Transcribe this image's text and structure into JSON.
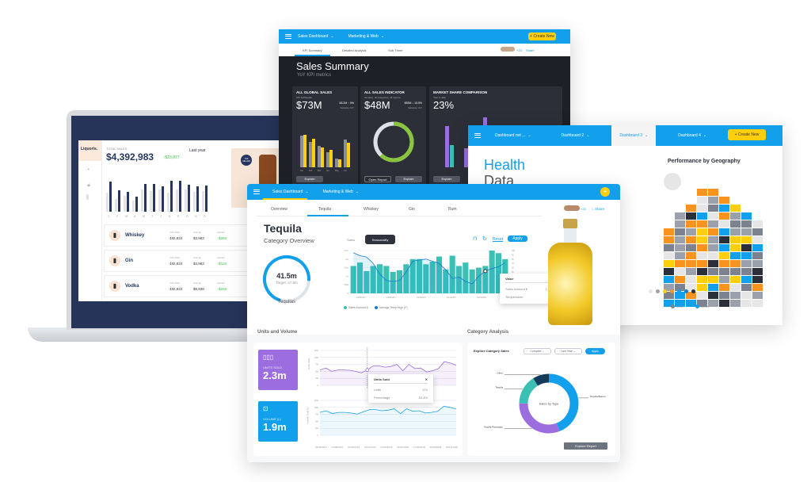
{
  "colors": {
    "blue": "#12a0ec",
    "teal": "#3cc0b6",
    "purple": "#9c6ddf",
    "yellow": "#ffcf0d",
    "navy": "#26365e",
    "dark": "#1d2027",
    "card": "#2c2f38",
    "green": "#8ac43f"
  },
  "laptop": {
    "logo": "Liquoris.",
    "total_label": "TOTAL SALES",
    "total_value": "$4,392,983",
    "delta": "↑$23,877",
    "period": "Last year",
    "months": [
      "J",
      "F",
      "M",
      "A",
      "M",
      "J",
      "J",
      "A",
      "S",
      "O",
      "N",
      "D"
    ],
    "bars_current": [
      85,
      60,
      55,
      42,
      78,
      78,
      72,
      86,
      86,
      75,
      72,
      74
    ],
    "bars_prev": [
      60,
      40,
      50,
      35,
      70,
      65,
      70,
      60,
      70,
      70,
      62,
      65
    ],
    "promo_badge": "TOP SELLER",
    "rows": [
      {
        "name": "Whiskey",
        "volume_label": "VOLUME",
        "volume": "492,834",
        "value_label": "VALUE",
        "value": "$3,983",
        "sales_label": "SALES",
        "sales": "↑$360"
      },
      {
        "name": "Gin",
        "volume_label": "VOLUME",
        "volume": "492,834",
        "value_label": "VALUE",
        "value": "$4,983",
        "sales_label": "SALES",
        "sales": "↑$120"
      },
      {
        "name": "Vodka",
        "volume_label": "VOLUME",
        "volume": "492,834",
        "value_label": "VALUE",
        "value": "$9,938",
        "sales_label": "SALES",
        "sales": "↑$340"
      }
    ]
  },
  "dark": {
    "nav": [
      "Sales Dashboard",
      "Marketing & Web"
    ],
    "create": "+ Create New",
    "tabs": [
      "KPI Summary",
      "Detailed Analysis",
      "Sub Three"
    ],
    "share": "Share",
    "count": "+23",
    "title": "Sales Summary",
    "subtitle": "YoY KPI metrics",
    "cards": [
      {
        "title": "ALL GLOBAL SALES",
        "sub": "KPI Subheader",
        "value": "$73M",
        "delta": "68.2M ↑ 9%",
        "delta_sub": "Variance YoY",
        "button": "Explain",
        "months": [
          "Jan",
          "Feb",
          "Mar",
          "Apr",
          "May",
          "Jun"
        ],
        "gray": [
          88,
          72,
          60,
          42,
          25,
          78
        ],
        "yellow": [
          92,
          80,
          55,
          50,
          22,
          70
        ]
      },
      {
        "title": "ALL SALES INDICATOR",
        "sub": "All sales, all categories, all regions",
        "value": "$48M",
        "delta": "$53M ↓ 13.5%",
        "delta_sub": "Variance YoY",
        "button": "Explain",
        "button2": "Open Report",
        "progress": 0.62
      },
      {
        "title": "MARKET SHARE COMPARISON",
        "sub": "Year to date",
        "value": "23%",
        "button": "Explain",
        "purple": [
          75,
          35,
          90
        ],
        "teal": [
          40,
          20,
          60
        ]
      }
    ]
  },
  "health": {
    "nav": [
      "Dashboard not ...",
      "Dashboard 2",
      "Dashboard 3",
      "Dashboard 4"
    ],
    "create": "+ Create New",
    "title1": "Health",
    "title2": "Data",
    "map_title": "Performance by Geography",
    "legend": [
      {
        "label": "2017",
        "color": "#7d8290"
      },
      {
        "label": "2018",
        "color": "#12a0ec"
      }
    ],
    "scale_colors": [
      "#e6e6e6",
      "#9aa1ad",
      "#ffcf0d",
      "#f7931e",
      "#12a0ec",
      "#0d7fd0",
      "#2b2f3a"
    ],
    "map_colors": [
      "#e6e6e6",
      "#9aa1ad",
      "#ffcf0d",
      "#f7931e",
      "#12a0ec",
      "#2b2f3a",
      "#7d8290"
    ]
  },
  "front": {
    "nav": [
      "Sales Dashboard",
      "Marketing & Web"
    ],
    "tabs": [
      "Overview",
      "Tequila",
      "Whiskey",
      "Gin",
      "Rum"
    ],
    "active_tab": 1,
    "count": "+23",
    "share": "Share",
    "title": "Tequila",
    "subtitle": "Category Overview",
    "gauge": {
      "value": "41.5m",
      "target": "Target: 47.8m",
      "label": "Tequilas",
      "fraction": 0.87
    },
    "toggle": [
      "Sales",
      "Seasonality"
    ],
    "reset": "Reset",
    "apply": "Apply",
    "chart": {
      "bars": [
        1.6,
        1.8,
        1.3,
        1.6,
        1.7,
        1.6,
        1.25,
        1.35,
        1.7,
        2.0,
        2.0,
        1.7,
        1.85,
        2.15,
        1.4,
        2.2,
        1.6,
        1.8,
        1.4,
        1.5,
        1.6,
        2.5,
        2.35,
        2.0
      ],
      "line": [
        95,
        88,
        85,
        70,
        45,
        30,
        28,
        30,
        50,
        75,
        78,
        80,
        75,
        70,
        55,
        35,
        38,
        28,
        22,
        40,
        52,
        58,
        62,
        72
      ],
      "y_left": [
        "0",
        "500k",
        "1m",
        "1.5m",
        "2m",
        "2.5m"
      ],
      "y_right": [
        "0",
        "10",
        "20",
        "30",
        "40",
        "50",
        "60",
        "70",
        "80",
        "90",
        "100"
      ],
      "x": [
        "01/06/2017",
        "01/08/2017",
        "01/09/2017",
        "01/12/2017",
        "01/03/2018",
        "01/05/2018"
      ],
      "legend": [
        "Sales Amount $",
        "Average Temp High (F)"
      ]
    },
    "tooltip": {
      "title": "Value",
      "rows": [
        [
          "Sales Amount $",
          "1,573,209"
        ],
        [
          "Temperature",
          "62"
        ]
      ]
    },
    "units_title": "Units and Volume",
    "units": {
      "label": "UNITS SOLD",
      "value": "2.3m"
    },
    "volume": {
      "label": "VOLUME (L)",
      "value": "1.9m"
    },
    "units_line": [
      55,
      62,
      50,
      55,
      55,
      54,
      50,
      45,
      55,
      70,
      70,
      65,
      68,
      75,
      52,
      75,
      60,
      62,
      48,
      52,
      60,
      85,
      80,
      72
    ],
    "volume_line": [
      82,
      88,
      78,
      82,
      82,
      80,
      76,
      84,
      92,
      92,
      88,
      90,
      95,
      78,
      95,
      86,
      88,
      80,
      82,
      86,
      104,
      100,
      94
    ],
    "units_axis": "Units Sold",
    "volume_axis": "Volume Sold (L)",
    "y_ticks": [
      "0",
      "25k",
      "50k",
      "75k",
      "100k",
      "125k"
    ],
    "x_ticks": [
      "01/06/2017",
      "01/08/2017",
      "01/09/2017",
      "01/12/2017",
      "01/02/2018",
      "01/03/2018",
      "01/05/2018",
      "01/08/2018",
      "01/12/2018"
    ],
    "units_tooltip": {
      "title": "Units Sold",
      "rows": [
        [
          "Units",
          "57k"
        ],
        [
          "Percentage",
          "53.4%"
        ]
      ]
    },
    "category_title": "Category Analysis",
    "explore": "Explore Category Sales",
    "compare": "Compare",
    "period": "Last Year",
    "donut": {
      "center": "Sales by Type",
      "slices": [
        {
          "label": "Tequila Blanco",
          "value": 44,
          "color": "#12a0ec"
        },
        {
          "label": "Tequila Reposado",
          "value": 31,
          "color": "#9c6ddf"
        },
        {
          "label": "Tequila",
          "value": 16,
          "color": "#3cc0b6"
        },
        {
          "label": "Other",
          "value": 9,
          "color": "#163a5c"
        }
      ]
    },
    "explore_report": "Explore Report"
  }
}
